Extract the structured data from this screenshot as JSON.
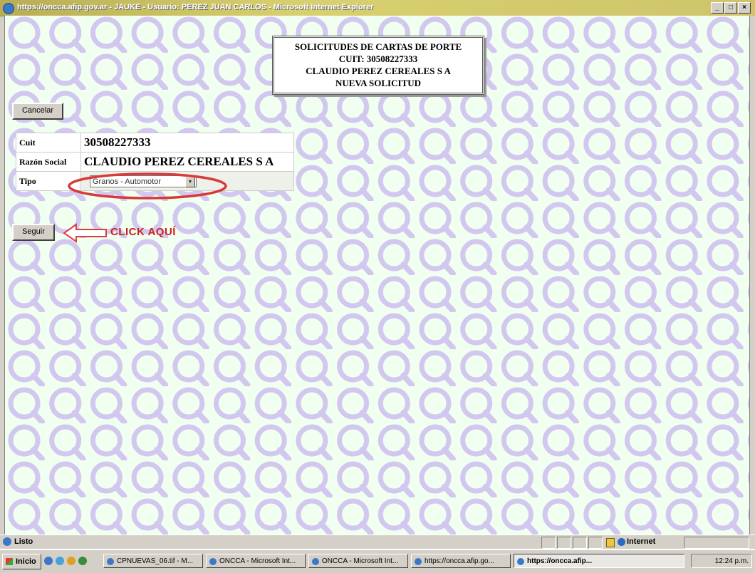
{
  "window": {
    "title": "https://oncca.afip.gov.ar - JAUKE - Usuario: PEREZ JUAN CARLOS - Microsoft Internet Explorer"
  },
  "header": {
    "line1": "SOLICITUDES DE CARTAS DE PORTE",
    "line2": "CUIT: 30508227333",
    "line3": "CLAUDIO PEREZ CEREALES S A",
    "line4": "NUEVA SOLICITUD"
  },
  "cancel_label": "Cancelar",
  "form": {
    "rows": [
      {
        "label": "Cuit",
        "value": "30508227333"
      },
      {
        "label": "Razón Social",
        "value": "CLAUDIO PEREZ CEREALES S A"
      },
      {
        "label": "Tipo",
        "value": "Granos - Automotor"
      }
    ]
  },
  "seguir_label": "Seguir",
  "annotation": {
    "text": "CLICK AQUÍ",
    "color": "#cc2020"
  },
  "status": {
    "text": "Listo",
    "zone": "Internet"
  },
  "taskbar": {
    "start": "Inicio",
    "tasks": [
      "CPNUEVAS_06.tif - M...",
      "ONCCA - Microsoft Int...",
      "ONCCA - Microsoft Int...",
      "https://oncca.afip.go...",
      "https://oncca.afip..."
    ],
    "clock": "12:24 p.m."
  }
}
